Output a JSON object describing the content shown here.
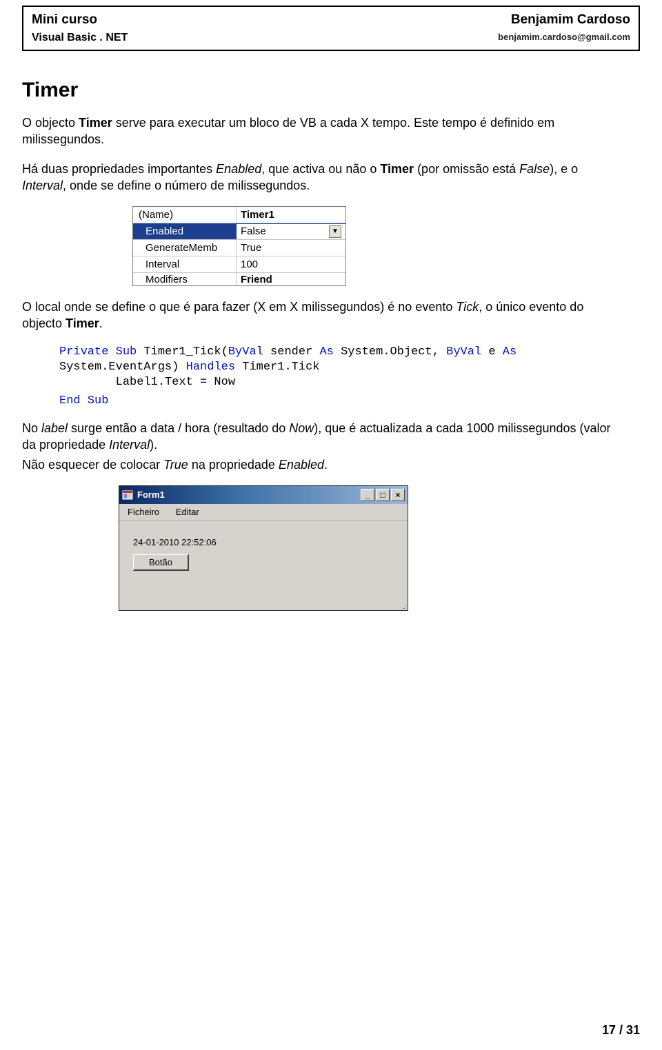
{
  "header": {
    "course": "Mini curso",
    "subtitle": "Visual Basic . NET",
    "author": "Benjamim Cardoso",
    "email": "benjamim.cardoso@gmail.com"
  },
  "title": "Timer",
  "para1_a": "O objecto ",
  "para1_b": "Timer",
  "para1_c": " serve para executar um bloco de VB a cada X tempo. Este tempo é definido em milissegundos.",
  "para2_a": "Há duas propriedades importantes ",
  "para2_enabled": "Enabled",
  "para2_b": ", que activa ou não o ",
  "para2_timer": "Timer",
  "para2_c": " (por omissão está ",
  "para2_false": "False",
  "para2_d": "), e o ",
  "para2_interval": "Interval",
  "para2_e": ", onde se define o número de milissegundos.",
  "propgrid": {
    "rows": [
      {
        "name": "(Name)",
        "value": "Timer1",
        "bold": true,
        "paren": true
      },
      {
        "name": "Enabled",
        "value": "False",
        "selected": true
      },
      {
        "name": "GenerateMemb",
        "value": "True"
      },
      {
        "name": "Interval",
        "value": "100"
      },
      {
        "name": "Modifiers",
        "value": "Friend",
        "bold": true,
        "cutoff": true
      }
    ]
  },
  "para3_a": "O local onde se define o que é para fazer (X em X milissegundos) é no evento ",
  "para3_tick": "Tick",
  "para3_b": ", o único evento do objecto ",
  "para3_timer": "Timer",
  "para3_c": ".",
  "code": {
    "l1_a": "Private Sub",
    "l1_b": " Timer1_Tick(",
    "l1_c": "ByVal",
    "l1_d": " sender ",
    "l1_e": "As",
    "l1_f": " System.Object, ",
    "l1_g": "ByVal",
    "l1_h": " e ",
    "l1_i": "As",
    "l2_a": "System.EventArgs) ",
    "l2_b": "Handles",
    "l2_c": " Timer1.Tick",
    "l3": "        Label1.Text = Now",
    "end": "End Sub"
  },
  "para4_a": "No ",
  "para4_label": "label",
  "para4_b": " surge então a data / hora (resultado do ",
  "para4_now": "Now",
  "para4_c": "), que é actualizada a cada 1000 milissegundos (valor da propriedade ",
  "para4_interval": "Interval",
  "para4_d": ").",
  "para5_a": "Não esquecer de colocar ",
  "para5_true": "True",
  "para5_b": " na propriedade ",
  "para5_enabled": "Enabled",
  "para5_c": ".",
  "form": {
    "title": "Form1",
    "menu1": "Ficheiro",
    "menu2": "Editar",
    "datetime": "24-01-2010 22:52:06",
    "button": "Botão"
  },
  "footer": "17 / 31"
}
